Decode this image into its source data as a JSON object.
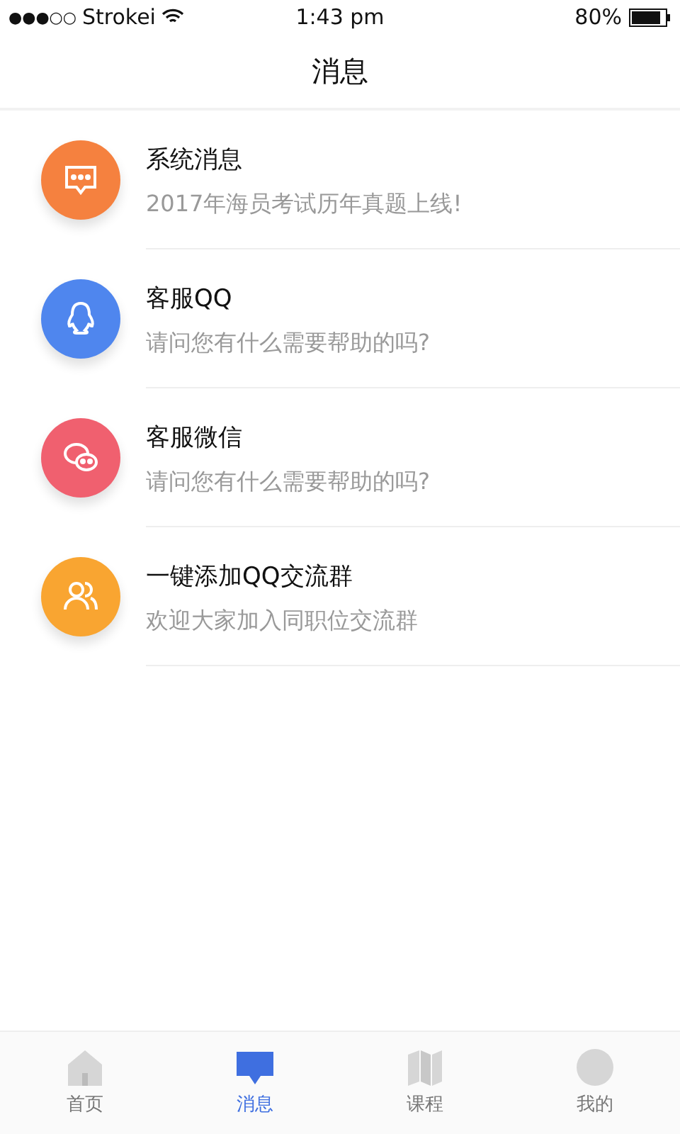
{
  "status_bar": {
    "signal": "●●●○○",
    "carrier": "Strokei",
    "time": "1:43 pm",
    "battery": "80%"
  },
  "header": {
    "title": "消息"
  },
  "messages": [
    {
      "kind": "chat",
      "color": "#f5813f",
      "title": "系统消息",
      "subtitle": "2017年海员考试历年真题上线!"
    },
    {
      "kind": "qq",
      "color": "#4f86ee",
      "title": "客服QQ",
      "subtitle": "请问您有什么需要帮助的吗?"
    },
    {
      "kind": "wechat",
      "color": "#f0606f",
      "title": "客服微信",
      "subtitle": "请问您有什么需要帮助的吗?"
    },
    {
      "kind": "group",
      "color": "#f9a531",
      "title": "一键添加QQ交流群",
      "subtitle": "欢迎大家加入同职位交流群"
    }
  ],
  "tabs": [
    {
      "kind": "home",
      "label": "首页",
      "selected": false
    },
    {
      "kind": "message",
      "label": "消息",
      "selected": true
    },
    {
      "kind": "course",
      "label": "课程",
      "selected": false
    },
    {
      "kind": "profile",
      "label": "我的",
      "selected": false
    }
  ]
}
